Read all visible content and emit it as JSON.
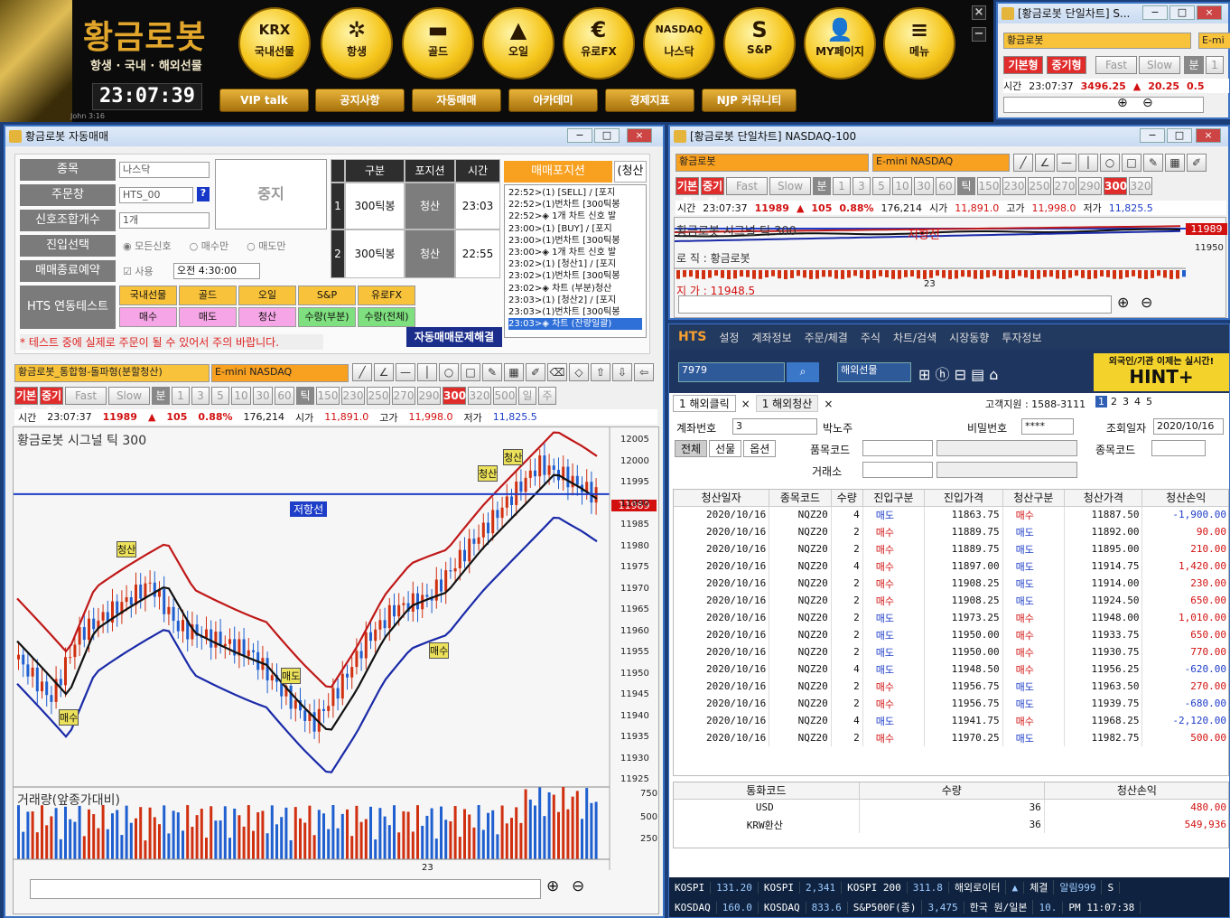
{
  "banner": {
    "brand": "황금로봇",
    "subtitle": "항생 · 국내 · 해외선물",
    "clock": "23:07:39",
    "footnote": "John 3:16",
    "big_buttons": [
      {
        "icon": "KRX",
        "label": "국내선물"
      },
      {
        "icon": "✲",
        "label": "항생"
      },
      {
        "icon": "▬",
        "label": "골드"
      },
      {
        "icon": "▲",
        "label": "오일"
      },
      {
        "icon": "€",
        "label": "유로FX"
      },
      {
        "icon": "NASDAQ",
        "label": "나스닥"
      },
      {
        "icon": "S",
        "label": "S&P"
      },
      {
        "icon": "👤",
        "label": "MY페이지"
      },
      {
        "icon": "≡",
        "label": "메뉴"
      }
    ],
    "menu_buttons": [
      "VIP talk",
      "공지사항",
      "자동매매",
      "아카데미",
      "경제지표",
      "NJP 커뮤니티"
    ],
    "close": "×",
    "min": "−"
  },
  "mini_chart": {
    "title": "[황금로봇 단일차트] S...",
    "combo1": "황금로봇",
    "combo2": "E-mi",
    "buttons": [
      "기본형",
      "중기형",
      "Fast",
      "Slow",
      "분",
      "1"
    ],
    "fields": [
      "시간",
      "23:07:37",
      "3496.25",
      "▲",
      "20.25",
      "0.5"
    ]
  },
  "auto": {
    "title": "황금로봇 자동매매",
    "labels": [
      "종목",
      "주문창",
      "신호조합개수",
      "진입선택",
      "매매종료예약",
      "HTS 연동테스트"
    ],
    "symbol": "나스닥",
    "order": "HTS_00",
    "qmark": "?",
    "count": "1개",
    "radios": [
      "모든신호",
      "매수만",
      "매도만"
    ],
    "use": "사용",
    "time": "오전 4:30:00",
    "stop": "중지",
    "grid_head": [
      "구분",
      "포지션",
      "시간"
    ],
    "grid_rows": [
      [
        "1",
        "300틱봉",
        "청산",
        "23:03"
      ],
      [
        "2",
        "300틱봉",
        "청산",
        "22:55"
      ]
    ],
    "pos_tab": "매매포지션",
    "pos_tab2": "(청산",
    "log": [
      "22:52>(1) [SELL] / [포지",
      "22:52>(1)번차트 [300틱봉",
      "22:52>◈ 1개 차트 신호 발",
      "23:00>(1) [BUY] / [포지",
      "23:00>(1)번차트 [300틱봉",
      "23:00>◈ 1개 차트 신호 발",
      "23:02>(1) [청산1] / [포지",
      "23:02>(1)번차트 [300틱봉",
      "23:02>◈ 차트 (부분)청산",
      "23:03>(1) [청산2] / [포지",
      "23:03>(1)번차트 [300틱봉",
      "23:03>◈ 차트 (잔량일괄)"
    ],
    "test_row1": [
      "국내선물",
      "골드",
      "오일",
      "S&P",
      "유로FX"
    ],
    "test_row2": [
      "매수",
      "매도",
      "청산",
      "수량(부분)",
      "수량(전체)"
    ],
    "warning": "* 테스트 중에 실제로 주문이 될 수 있어서 주의 바랍니다.",
    "resolve": "자동매매문제해결"
  },
  "big_chart": {
    "combo1": "황금로봇_통합형-돌파형(분할청산)",
    "combo2": "E-mini NASDAQ",
    "buttons": [
      "기본형",
      "중기형",
      "Fast",
      "Slow",
      "분",
      "1",
      "3",
      "5",
      "10",
      "30",
      "60",
      "틱",
      "150",
      "230",
      "250",
      "270",
      "290",
      "300",
      "320",
      "500",
      "일",
      "주"
    ],
    "info": [
      "시간",
      "23:07:37",
      "11989",
      "▲",
      "105",
      "0.88%",
      "176,214",
      "시가",
      "11,891.0",
      "고가",
      "11,998.0",
      "저가",
      "11,825.5"
    ],
    "signal_label": "황금로봇 시그널  틱 300",
    "resist": "저항선",
    "price_tag": "11989",
    "y_ticks": [
      "12005",
      "12000",
      "11995",
      "11990",
      "11985",
      "11980",
      "11975",
      "11970",
      "11965",
      "11960",
      "11955",
      "11950",
      "11945",
      "11940",
      "11935",
      "11930",
      "11925"
    ],
    "markers": [
      "청산",
      "청산",
      "청산",
      "매도",
      "매수",
      "매수"
    ],
    "vol_label": "거래량(앞종가대비)",
    "vol_ticks": [
      "750",
      "500",
      "250"
    ],
    "x_tick": "23"
  },
  "nas_chart": {
    "title": "[황금로봇 단일차트] NASDAQ-100",
    "combo1": "황금로봇",
    "combo2": "E-mini NASDAQ",
    "buttons": [
      "기본형",
      "중기형",
      "Fast",
      "Slow",
      "분",
      "1",
      "3",
      "5",
      "10",
      "30",
      "60",
      "틱",
      "150",
      "230",
      "250",
      "270",
      "290",
      "300",
      "320"
    ],
    "info": [
      "시간",
      "23:07:37",
      "11989",
      "▲",
      "105",
      "0.88%",
      "176,214",
      "시가",
      "11,891.0",
      "고가",
      "11,998.0",
      "저가",
      "11,825.5"
    ],
    "signal": "황금로봇 시그널  틱 300",
    "resist": "저항선",
    "price_tag": "11989",
    "tick2": "11950",
    "x_tick": "23",
    "sub1": "로  직 : 황금로봇",
    "sub2": "지  가 : 11948.5"
  },
  "hts": {
    "brand": "HTS",
    "menu": [
      "설정",
      "계좌정보",
      "주문/체결",
      "주식",
      "차트/검색",
      "시장동향",
      "투자정보"
    ],
    "acct_combo": "7979",
    "market": "해외선물",
    "ad1": "외국인/기관 이제는 실시간!",
    "ad2": "HINT+",
    "tabs": [
      "1 해외클릭",
      "1 해외청산"
    ],
    "support": "고객지원 : 1588-3111",
    "pages": [
      "1",
      "2",
      "3",
      "4",
      "5"
    ],
    "acct_label": "계좌번호",
    "acct_no": "3",
    "acct_name": "박노주",
    "pw_label": "비밀번호",
    "pw": "****",
    "date_label": "조회일자",
    "date": "2020/10/16",
    "filter_tabs": [
      "전체",
      "선물",
      "옵션"
    ],
    "code_label": "품목코드",
    "exch_label": "거래소",
    "item_label": "종목코드",
    "cols": [
      "청산일자",
      "종목코드",
      "수량",
      "진입구분",
      "진입가격",
      "청산구분",
      "청산가격",
      "청산손익"
    ],
    "rows": [
      [
        "2020/10/16",
        "NQZ20",
        "4",
        "매도",
        "11863.75",
        "매수",
        "11887.50",
        "-1,900.00"
      ],
      [
        "2020/10/16",
        "NQZ20",
        "2",
        "매수",
        "11889.75",
        "매도",
        "11892.00",
        "90.00"
      ],
      [
        "2020/10/16",
        "NQZ20",
        "2",
        "매수",
        "11889.75",
        "매도",
        "11895.00",
        "210.00"
      ],
      [
        "2020/10/16",
        "NQZ20",
        "4",
        "매수",
        "11897.00",
        "매도",
        "11914.75",
        "1,420.00"
      ],
      [
        "2020/10/16",
        "NQZ20",
        "2",
        "매수",
        "11908.25",
        "매도",
        "11914.00",
        "230.00"
      ],
      [
        "2020/10/16",
        "NQZ20",
        "2",
        "매수",
        "11908.25",
        "매도",
        "11924.50",
        "650.00"
      ],
      [
        "2020/10/16",
        "NQZ20",
        "2",
        "매도",
        "11973.25",
        "매수",
        "11948.00",
        "1,010.00"
      ],
      [
        "2020/10/16",
        "NQZ20",
        "2",
        "매도",
        "11950.00",
        "매수",
        "11933.75",
        "650.00"
      ],
      [
        "2020/10/16",
        "NQZ20",
        "2",
        "매도",
        "11950.00",
        "매수",
        "11930.75",
        "770.00"
      ],
      [
        "2020/10/16",
        "NQZ20",
        "4",
        "매도",
        "11948.50",
        "매수",
        "11956.25",
        "-620.00"
      ],
      [
        "2020/10/16",
        "NQZ20",
        "2",
        "매수",
        "11956.75",
        "매도",
        "11963.50",
        "270.00"
      ],
      [
        "2020/10/16",
        "NQZ20",
        "2",
        "매수",
        "11956.75",
        "매도",
        "11939.75",
        "-680.00"
      ],
      [
        "2020/10/16",
        "NQZ20",
        "4",
        "매도",
        "11941.75",
        "매수",
        "11968.25",
        "-2,120.00"
      ],
      [
        "2020/10/16",
        "NQZ20",
        "2",
        "매수",
        "11970.25",
        "매도",
        "11982.75",
        "500.00"
      ]
    ],
    "sum_cols": [
      "통화코드",
      "수량",
      "청산손익"
    ],
    "sum_rows": [
      [
        "USD",
        "36",
        "480.00"
      ],
      [
        "KRW환산",
        "36",
        "549,936"
      ]
    ]
  },
  "ticker": {
    "r1": [
      "KOSPI",
      "131.20",
      "KOSPI",
      "2,341",
      "KOSPI 200",
      "311.8",
      "해외로이터",
      "▲",
      "체결",
      "알림999",
      "S"
    ],
    "r2": [
      "KOSDAQ",
      "160.0",
      "KOSDAQ",
      "833.6",
      "S&P500F(종)",
      "3,475",
      "한국 원/일본",
      "10.",
      "PM 11:07:38"
    ]
  }
}
